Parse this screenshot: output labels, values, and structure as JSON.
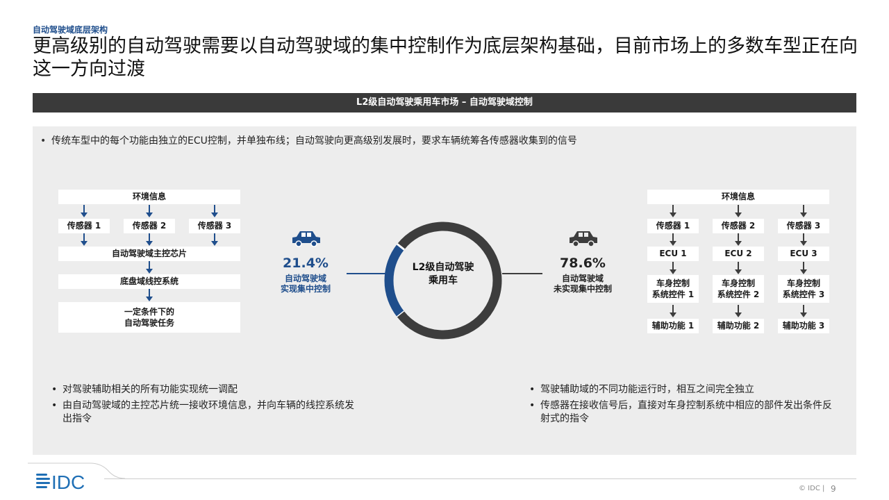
{
  "header": {
    "section_tag": "自动驾驶域底层架构",
    "title": "更高级别的自动驾驶需要以自动驾驶域的集中控制作为底层架构基础，目前市场上的多数车型正在向这一方向过渡"
  },
  "banner": "L2级自动驾驶乘用车市场 – 自动驾驶域控制",
  "intro": "传统车型中的每个功能由独立的ECU控制，并单独布线；自动驾驶向更高级别发展时，要求车辆统筹各传感器收集到的信号",
  "left_flow": {
    "env_info": "环境信息",
    "sensors": [
      "传感器 1",
      "传感器 2",
      "传感器 3"
    ],
    "main_chip": "自动驾驶域主控芯片",
    "chassis": "底盘域线控系统",
    "task_line1": "一定条件下的",
    "task_line2": "自动驾驶任务"
  },
  "right_flow": {
    "env_info": "环境信息",
    "sensors": [
      "传感器 1",
      "传感器 2",
      "传感器 3"
    ],
    "ecus": [
      "ECU 1",
      "ECU 2",
      "ECU 3"
    ],
    "body_line1": [
      "车身控制",
      "车身控制",
      "车身控制"
    ],
    "body_line2": [
      "系统控件 1",
      "系统控件 2",
      "系统控件 3"
    ],
    "assist": [
      "辅助功能 1",
      "辅助功能 2",
      "辅助功能 3"
    ]
  },
  "chart_data": {
    "type": "pie",
    "center_label_line1": "L2级自动驾驶",
    "center_label_line2": "乘用车",
    "series": [
      {
        "value": 21.4,
        "value_label": "21.4%",
        "label_line1": "自动驾驶域",
        "label_line2": "实现集中控制",
        "color": "#1f4e8c"
      },
      {
        "value": 78.6,
        "value_label": "78.6%",
        "label_line1": "自动驾驶域",
        "label_line2": "未实现集中控制",
        "color": "#3d3d3d"
      }
    ]
  },
  "notes_left": [
    "对驾驶辅助相关的所有功能实现统一调配",
    "由自动驾驶域的主控芯片统一接收环境信息，并向车辆的线控系统发出指令"
  ],
  "notes_right": [
    "驾驶辅助域的不同功能运行时，相互之间完全独立",
    "传感器在接收信号后，直接对车身控制系统中相应的部件发出条件反射式的指令"
  ],
  "footer": {
    "logo_text": "IDC",
    "copyright": "© IDC |",
    "page_number": "9"
  },
  "colors": {
    "accent_blue": "#1f4e8c",
    "dark_gray": "#3d3d3d",
    "panel_bg": "#ededed",
    "banner_bg": "#3a3a3a"
  }
}
